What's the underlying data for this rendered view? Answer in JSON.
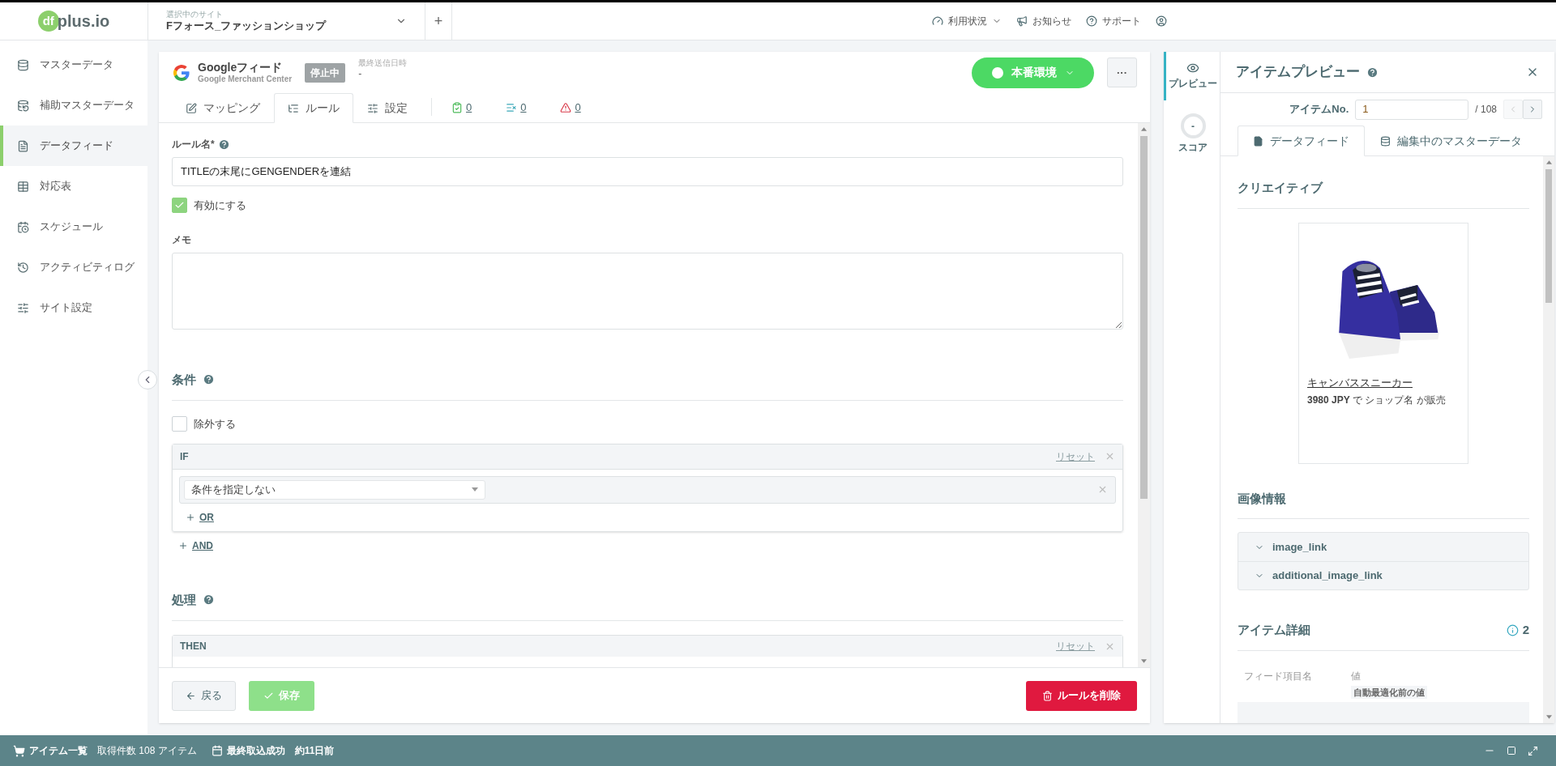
{
  "logo": {
    "mark": "df",
    "text": "plus.io"
  },
  "site_selector": {
    "label": "選択中のサイト",
    "value": "Fフォース_ファッションショップ",
    "add": "+"
  },
  "header_links": [
    {
      "kind": "usage",
      "label": "利用状況"
    },
    {
      "kind": "news",
      "label": "お知らせ"
    },
    {
      "kind": "support",
      "label": "サポート"
    },
    {
      "kind": "account"
    }
  ],
  "sidebar": {
    "items": [
      {
        "kind": "master",
        "label": "マスターデータ",
        "selected": false
      },
      {
        "kind": "sub-master",
        "label": "補助マスターデータ",
        "selected": false
      },
      {
        "kind": "feed",
        "label": "データフィード",
        "selected": true
      },
      {
        "kind": "table",
        "label": "対応表",
        "selected": false
      },
      {
        "kind": "schedule",
        "label": "スケジュール",
        "selected": false
      },
      {
        "kind": "log",
        "label": "アクティビティログ",
        "selected": false
      },
      {
        "kind": "settings",
        "label": "サイト設定",
        "selected": false
      }
    ]
  },
  "feed": {
    "name": "Googleフィード",
    "service": "Google Merchant Center",
    "status": "停止中",
    "last_sent_label": "最終送信日時",
    "last_sent": "-",
    "environment": "本番環境",
    "more": "···"
  },
  "tabs": [
    {
      "kind": "mapping",
      "label": "マッピング",
      "selected": false
    },
    {
      "kind": "rule",
      "label": "ルール",
      "selected": true
    },
    {
      "kind": "settings",
      "label": "設定",
      "selected": false
    }
  ],
  "counters": [
    {
      "kind": "ok",
      "value": "0"
    },
    {
      "kind": "excluded",
      "value": "0"
    },
    {
      "kind": "warning",
      "value": "0"
    }
  ],
  "form": {
    "rule_name_label": "ルール名*",
    "rule_name": "TITLEの末尾にGENGENDERを連結",
    "enabled": {
      "label": "有効にする",
      "checked": true
    },
    "memo_label": "メモ"
  },
  "conditions": {
    "title": "条件",
    "exclude": {
      "label": "除外する",
      "checked": false
    },
    "if_block": {
      "title": "IF",
      "reset": "リセット",
      "condition": "条件を指定しない",
      "or": "OR"
    },
    "and": "AND"
  },
  "processing": {
    "title": "処理",
    "then_block": {
      "title": "THEN",
      "reset": "リセット"
    }
  },
  "footer": {
    "back": "戻る",
    "save": "保存",
    "delete": "ルールを削除"
  },
  "preview": {
    "side_tabs": [
      {
        "kind": "preview",
        "label": "プレビュー",
        "selected": true
      },
      {
        "kind": "score",
        "label": "スコア",
        "score": "-",
        "selected": false
      }
    ],
    "title": "アイテムプレビュー",
    "item_no_label": "アイテムNo.",
    "item_no": "1",
    "total": "/ 108",
    "pager": [
      {
        "kind": "prev",
        "disabled": true
      },
      {
        "kind": "next",
        "disabled": false
      }
    ],
    "tabs": [
      {
        "kind": "feed",
        "label": "データフィード",
        "selected": true
      },
      {
        "kind": "master",
        "label": "編集中のマスターデータ",
        "selected": false
      }
    ],
    "creative_title": "クリエイティブ",
    "product_link": "キャンバススニーカー",
    "price_text": "**3980 JPY** で ショップ名 が販売",
    "image_info_title": "画像情報",
    "image_links": [
      {
        "label": "image_link",
        "expanded": false
      },
      {
        "label": "additional_image_link",
        "expanded": false
      }
    ],
    "details_title": "アイテム詳細",
    "details_count": "2",
    "columns": [
      "フィード項目名",
      "値"
    ],
    "value_badge": "自動最適化前の値"
  },
  "status_bar": {
    "items": [
      {
        "kind": "cart",
        "label": "アイテム一覧"
      },
      {
        "kind": "text",
        "label": "取得件数 108 アイテム"
      },
      {
        "kind": "calendar",
        "label": "最終取込成功"
      },
      {
        "kind": "text",
        "label": "約11日前"
      }
    ]
  }
}
